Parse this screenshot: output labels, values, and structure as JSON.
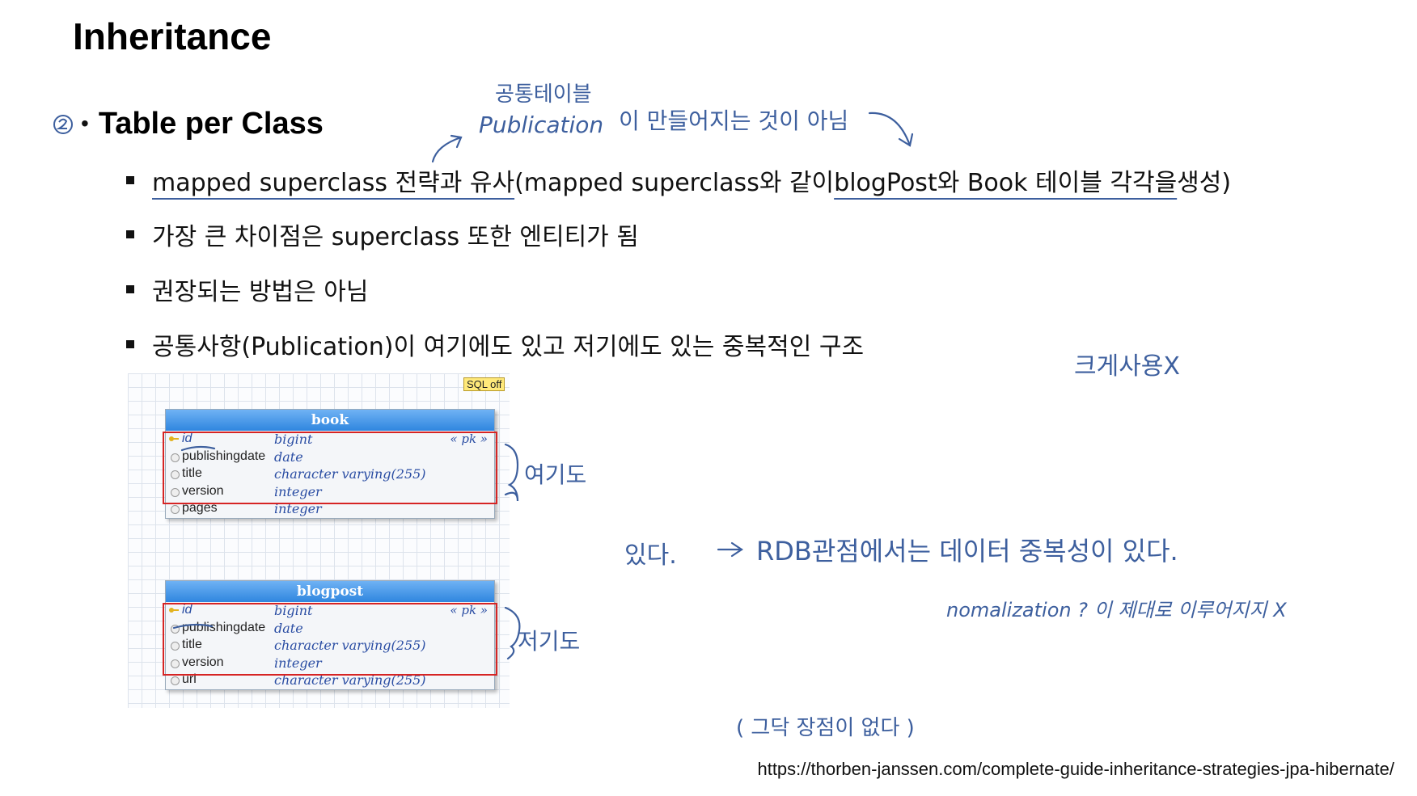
{
  "title": "Inheritance",
  "heading": {
    "bullet": "•",
    "text": "Table per Class"
  },
  "bullets": [
    {
      "underlined_a": "mapped superclass 전략과 유사",
      "plain_a": "(mapped superclass와 같이 ",
      "underlined_b": "blogPost와 Book 테이블 각각을",
      "plain_b": " 생성)"
    },
    {
      "text": "가장 큰 차이점은 superclass 또한 엔티티가 됨"
    },
    {
      "text": "권장되는 방법은 아님"
    },
    {
      "text": "공통사항(Publication)이 여기에도 있고 저기에도 있는 중복적인 구조"
    }
  ],
  "diagram": {
    "badge": "SQL off",
    "tables": [
      {
        "name": "book",
        "rows": [
          {
            "name": "id",
            "type": "bigint",
            "pk": "« pk »"
          },
          {
            "name": "publishingdate",
            "type": "date",
            "pk": ""
          },
          {
            "name": "title",
            "type": "character varying(255)",
            "pk": ""
          },
          {
            "name": "version",
            "type": "integer",
            "pk": ""
          },
          {
            "name": "pages",
            "type": "integer",
            "pk": ""
          }
        ]
      },
      {
        "name": "blogpost",
        "rows": [
          {
            "name": "id",
            "type": "bigint",
            "pk": "« pk »"
          },
          {
            "name": "publishingdate",
            "type": "date",
            "pk": ""
          },
          {
            "name": "title",
            "type": "character varying(255)",
            "pk": ""
          },
          {
            "name": "version",
            "type": "integer",
            "pk": ""
          },
          {
            "name": "url",
            "type": "character varying(255)",
            "pk": ""
          }
        ]
      }
    ]
  },
  "handwriting": {
    "note_top_a": "공통테이블",
    "note_top_b": "Publication",
    "note_top_c": "이 만들어지는 것이 아님",
    "note_right_top": "크게사용X",
    "note_here": "여기도",
    "note_there": "저기도",
    "note_exists": "있다.",
    "note_rdb": "RDB관점에서는 데이터 중복성이 있다.",
    "note_norm": "nomalization ? 이 제대로 이루어지지 X",
    "note_merit": "( 그닥 장점이 없다 )"
  },
  "source": "https://thorben-janssen.com/complete-guide-inheritance-strategies-jpa-hibernate/",
  "colors": {
    "ink": "#3d5f9e",
    "table_header": "#2f86df",
    "highlight_box": "#d62424",
    "badge": "#ffe97a"
  }
}
